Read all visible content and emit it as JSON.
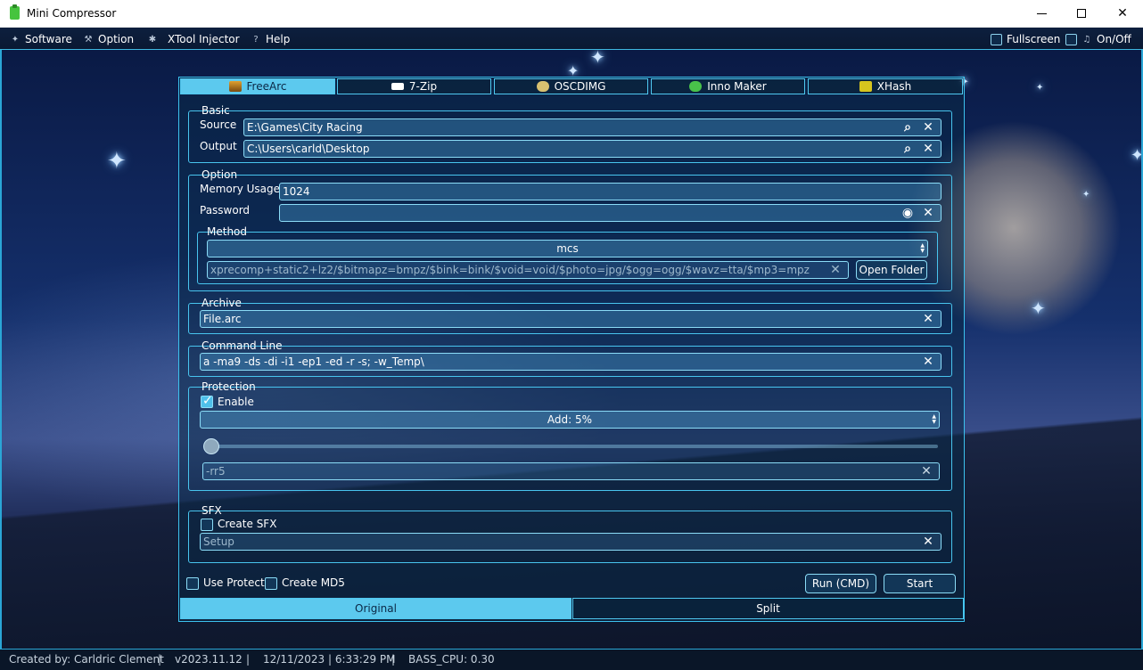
{
  "window": {
    "title": "Mini Compressor"
  },
  "menu": {
    "items": [
      {
        "label": "Software",
        "icon": "tools-icon"
      },
      {
        "label": "Option",
        "icon": "hammer-icon"
      },
      {
        "label": "XTool Injector",
        "icon": "bug-icon"
      },
      {
        "label": "Help",
        "icon": "question-icon"
      }
    ],
    "fullscreen_label": "Fullscreen",
    "onoff_label": "On/Off"
  },
  "tabs": [
    {
      "label": "FreeArc",
      "icon": "freearc-icon",
      "active": true
    },
    {
      "label": "7-Zip",
      "icon": "7zip-icon",
      "active": false
    },
    {
      "label": "OSCDIMG",
      "icon": "disc-icon",
      "active": false
    },
    {
      "label": "Inno Maker",
      "icon": "inno-icon",
      "active": false
    },
    {
      "label": "XHash",
      "icon": "xhash-icon",
      "active": false
    }
  ],
  "basic": {
    "legend": "Basic",
    "source_label": "Source",
    "source_value": "E:\\Games\\City Racing",
    "output_label": "Output",
    "output_value": "C:\\Users\\carld\\Desktop"
  },
  "option": {
    "legend": "Option",
    "memory_label": "Memory Usage",
    "memory_value": "1024",
    "password_label": "Password",
    "password_value": ""
  },
  "method": {
    "legend": "Method",
    "selected": "mcs",
    "params": "xprecomp+static2+lz2/$bitmapz=bmpz/$bink=bink/$void=void/$photo=jpg/$ogg=ogg/$wavz=tta/$mp3=mpz",
    "open_folder_label": "Open Folder"
  },
  "archive": {
    "legend": "Archive",
    "value": "File.arc"
  },
  "command_line": {
    "legend": "Command Line",
    "value": "a -ma9 -ds -di -i1 -ep1 -ed -r -s; -w_Temp\\"
  },
  "protection": {
    "legend": "Protection",
    "enable_label": "Enable",
    "enabled": true,
    "selected": "Add: 5%",
    "slider_value": 0,
    "param": "-rr5"
  },
  "sfx": {
    "legend": "SFX",
    "create_label": "Create SFX",
    "checked": false,
    "placeholder": "Setup"
  },
  "footer": {
    "use_protect_label": "Use Protect",
    "create_md5_label": "Create MD5",
    "run_cmd_label": "Run (CMD)",
    "start_label": "Start"
  },
  "bottom_tabs": [
    {
      "label": "Original",
      "active": true
    },
    {
      "label": "Split",
      "active": false
    }
  ],
  "status": {
    "author": "Created by: Carldric Clement",
    "sep": "|",
    "version": "v2023.11.12",
    "datetime": "12/11/2023 | 6:33:29 PM",
    "bass_cpu": "BASS_CPU: 0.30"
  },
  "colors": {
    "accent": "#4fc8f0",
    "active_tab": "#5cc9ee",
    "statusbar": "#0a1628"
  }
}
